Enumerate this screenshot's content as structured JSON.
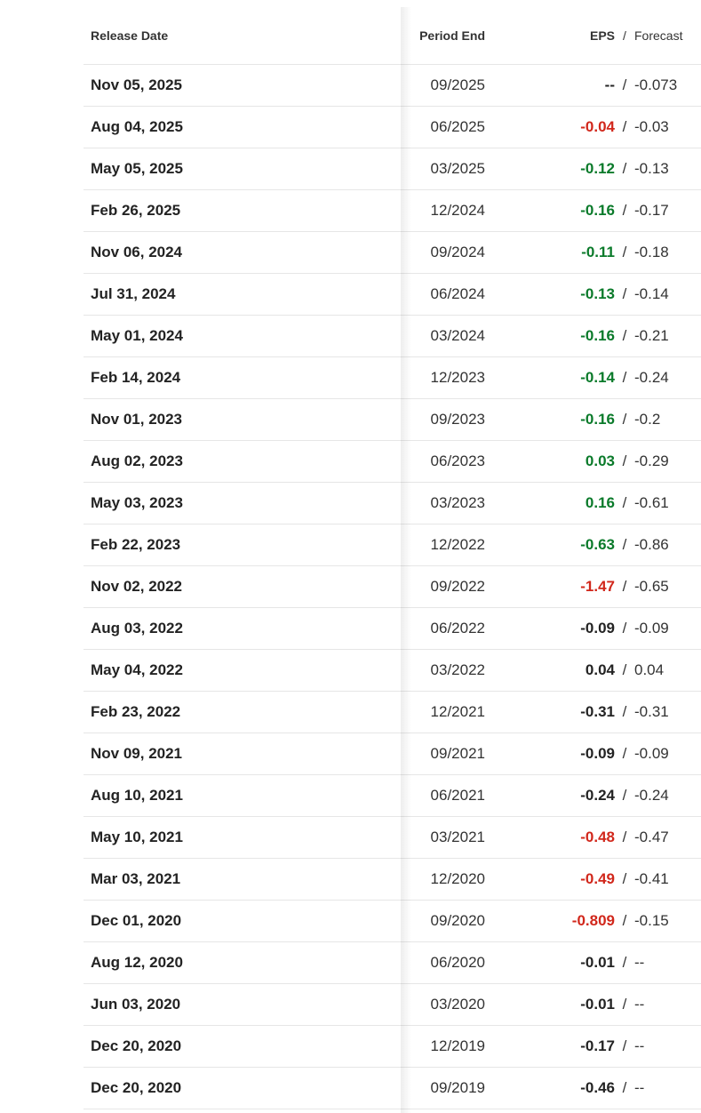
{
  "header": {
    "release_date": "Release Date",
    "period_end": "Period End",
    "eps": "EPS",
    "separator": "/",
    "forecast": "Forecast"
  },
  "colors": {
    "positive_surprise": "#0a7a2a",
    "negative_surprise": "#d1271b",
    "neutral": "#232323"
  },
  "rows": [
    {
      "release_date": "Nov 05, 2025",
      "period_end": "09/2025",
      "eps": "--",
      "forecast": "-0.073",
      "eps_status": "neutral"
    },
    {
      "release_date": "Aug 04, 2025",
      "period_end": "06/2025",
      "eps": "-0.04",
      "forecast": "-0.03",
      "eps_status": "red"
    },
    {
      "release_date": "May 05, 2025",
      "period_end": "03/2025",
      "eps": "-0.12",
      "forecast": "-0.13",
      "eps_status": "green"
    },
    {
      "release_date": "Feb 26, 2025",
      "period_end": "12/2024",
      "eps": "-0.16",
      "forecast": "-0.17",
      "eps_status": "green"
    },
    {
      "release_date": "Nov 06, 2024",
      "period_end": "09/2024",
      "eps": "-0.11",
      "forecast": "-0.18",
      "eps_status": "green"
    },
    {
      "release_date": "Jul 31, 2024",
      "period_end": "06/2024",
      "eps": "-0.13",
      "forecast": "-0.14",
      "eps_status": "green"
    },
    {
      "release_date": "May 01, 2024",
      "period_end": "03/2024",
      "eps": "-0.16",
      "forecast": "-0.21",
      "eps_status": "green"
    },
    {
      "release_date": "Feb 14, 2024",
      "period_end": "12/2023",
      "eps": "-0.14",
      "forecast": "-0.24",
      "eps_status": "green"
    },
    {
      "release_date": "Nov 01, 2023",
      "period_end": "09/2023",
      "eps": "-0.16",
      "forecast": "-0.2",
      "eps_status": "green"
    },
    {
      "release_date": "Aug 02, 2023",
      "period_end": "06/2023",
      "eps": "0.03",
      "forecast": "-0.29",
      "eps_status": "green"
    },
    {
      "release_date": "May 03, 2023",
      "period_end": "03/2023",
      "eps": "0.16",
      "forecast": "-0.61",
      "eps_status": "green"
    },
    {
      "release_date": "Feb 22, 2023",
      "period_end": "12/2022",
      "eps": "-0.63",
      "forecast": "-0.86",
      "eps_status": "green"
    },
    {
      "release_date": "Nov 02, 2022",
      "period_end": "09/2022",
      "eps": "-1.47",
      "forecast": "-0.65",
      "eps_status": "red"
    },
    {
      "release_date": "Aug 03, 2022",
      "period_end": "06/2022",
      "eps": "-0.09",
      "forecast": "-0.09",
      "eps_status": "neutral"
    },
    {
      "release_date": "May 04, 2022",
      "period_end": "03/2022",
      "eps": "0.04",
      "forecast": "0.04",
      "eps_status": "neutral"
    },
    {
      "release_date": "Feb 23, 2022",
      "period_end": "12/2021",
      "eps": "-0.31",
      "forecast": "-0.31",
      "eps_status": "neutral"
    },
    {
      "release_date": "Nov 09, 2021",
      "period_end": "09/2021",
      "eps": "-0.09",
      "forecast": "-0.09",
      "eps_status": "neutral"
    },
    {
      "release_date": "Aug 10, 2021",
      "period_end": "06/2021",
      "eps": "-0.24",
      "forecast": "-0.24",
      "eps_status": "neutral"
    },
    {
      "release_date": "May 10, 2021",
      "period_end": "03/2021",
      "eps": "-0.48",
      "forecast": "-0.47",
      "eps_status": "red"
    },
    {
      "release_date": "Mar 03, 2021",
      "period_end": "12/2020",
      "eps": "-0.49",
      "forecast": "-0.41",
      "eps_status": "red"
    },
    {
      "release_date": "Dec 01, 2020",
      "period_end": "09/2020",
      "eps": "-0.809",
      "forecast": "-0.15",
      "eps_status": "red"
    },
    {
      "release_date": "Aug 12, 2020",
      "period_end": "06/2020",
      "eps": "-0.01",
      "forecast": "--",
      "eps_status": "neutral"
    },
    {
      "release_date": "Jun 03, 2020",
      "period_end": "03/2020",
      "eps": "-0.01",
      "forecast": "--",
      "eps_status": "neutral"
    },
    {
      "release_date": "Dec 20, 2020",
      "period_end": "12/2019",
      "eps": "-0.17",
      "forecast": "--",
      "eps_status": "neutral"
    },
    {
      "release_date": "Dec 20, 2020",
      "period_end": "09/2019",
      "eps": "-0.46",
      "forecast": "--",
      "eps_status": "neutral"
    }
  ]
}
